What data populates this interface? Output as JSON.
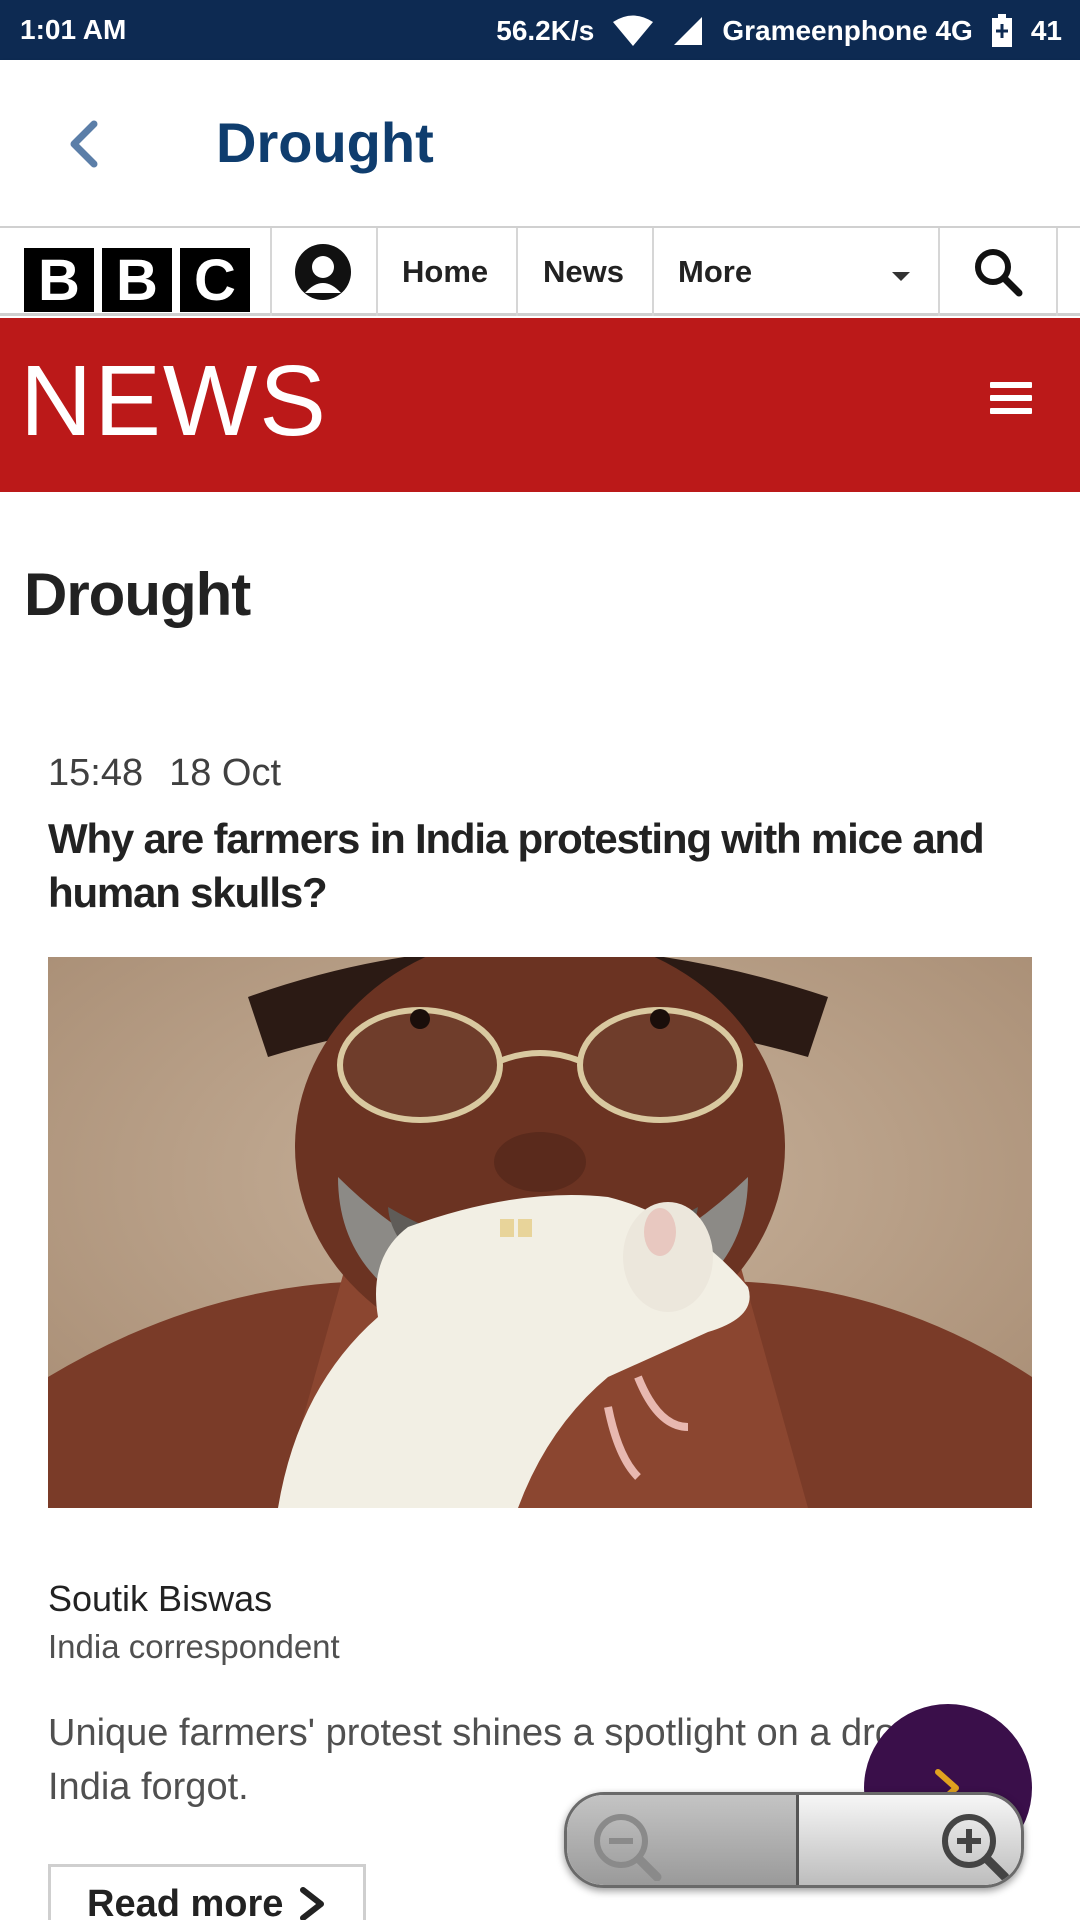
{
  "status_bar": {
    "time": "1:01 AM",
    "speed": "56.2K/s",
    "carrier": "Grameenphone 4G",
    "battery": "41",
    "icons": [
      "wifi-icon",
      "signal-icon",
      "battery-icon"
    ]
  },
  "app_bar": {
    "title": "Drought",
    "back_icon": "chevron-left-icon"
  },
  "bbc_nav": {
    "logo_letters": [
      "B",
      "B",
      "C"
    ],
    "account_icon": "account-icon",
    "links": [
      "Home",
      "News",
      "More"
    ],
    "search_icon": "search-icon"
  },
  "news_banner": {
    "wordmark": "NEWS",
    "menu_icon": "hamburger-menu-icon"
  },
  "page": {
    "title": "Drought"
  },
  "article": {
    "time": "15:48",
    "date": "18 Oct",
    "headline": "Why are farmers in India protesting with mice and human skulls?",
    "author": "Soutik Biswas",
    "role": "India correspondent",
    "summary": "Unique farmers' protest shines a spotlight on a drought India forgot.",
    "read_more": "Read more"
  },
  "overlay": {
    "fab_icon": "chevron-right-icon",
    "zoom_out_icon": "zoom-out-icon",
    "zoom_in_icon": "zoom-in-icon"
  },
  "colors": {
    "status_bar": "#0d2a52",
    "app_title": "#0f3d6e",
    "bbc_red": "#bb1919",
    "fab": "#3a0f4a",
    "fab_arrow": "#e0a21f"
  }
}
